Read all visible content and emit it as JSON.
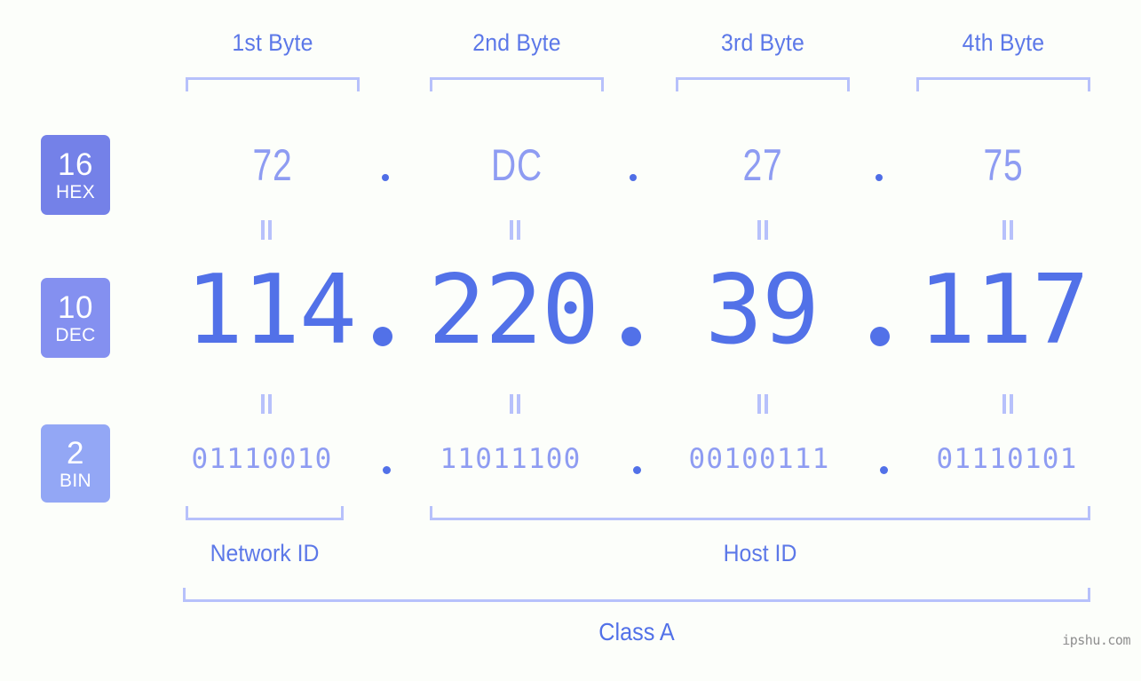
{
  "background_color": "#fcfefa",
  "accent_colors": {
    "strong_blue": "#5271e8",
    "medium_blue": "#8e9cf2",
    "light_blue": "#b7c1fb",
    "header_blue": "#5c78e8"
  },
  "byte_headers": [
    {
      "label": "1st Byte"
    },
    {
      "label": "2nd Byte"
    },
    {
      "label": "3rd Byte"
    },
    {
      "label": "4th Byte"
    }
  ],
  "bases": [
    {
      "num": "16",
      "name": "HEX",
      "color": "#7481e8"
    },
    {
      "num": "10",
      "name": "DEC",
      "color": "#8490f0"
    },
    {
      "num": "2",
      "name": "BIN",
      "color": "#93a7f5"
    }
  ],
  "rows": {
    "hex": {
      "values": [
        "72",
        "DC",
        "27",
        "75"
      ],
      "separator": "."
    },
    "dec": {
      "values": [
        "114",
        "220",
        "39",
        "117"
      ],
      "separator": "."
    },
    "bin": {
      "values": [
        "01110010",
        "11011100",
        "00100111",
        "01110101"
      ],
      "separator": "."
    }
  },
  "equals_symbol": "=",
  "segments": {
    "network_id": "Network ID",
    "host_id": "Host ID"
  },
  "class_label": "Class A",
  "watermark": "ipshu.com"
}
